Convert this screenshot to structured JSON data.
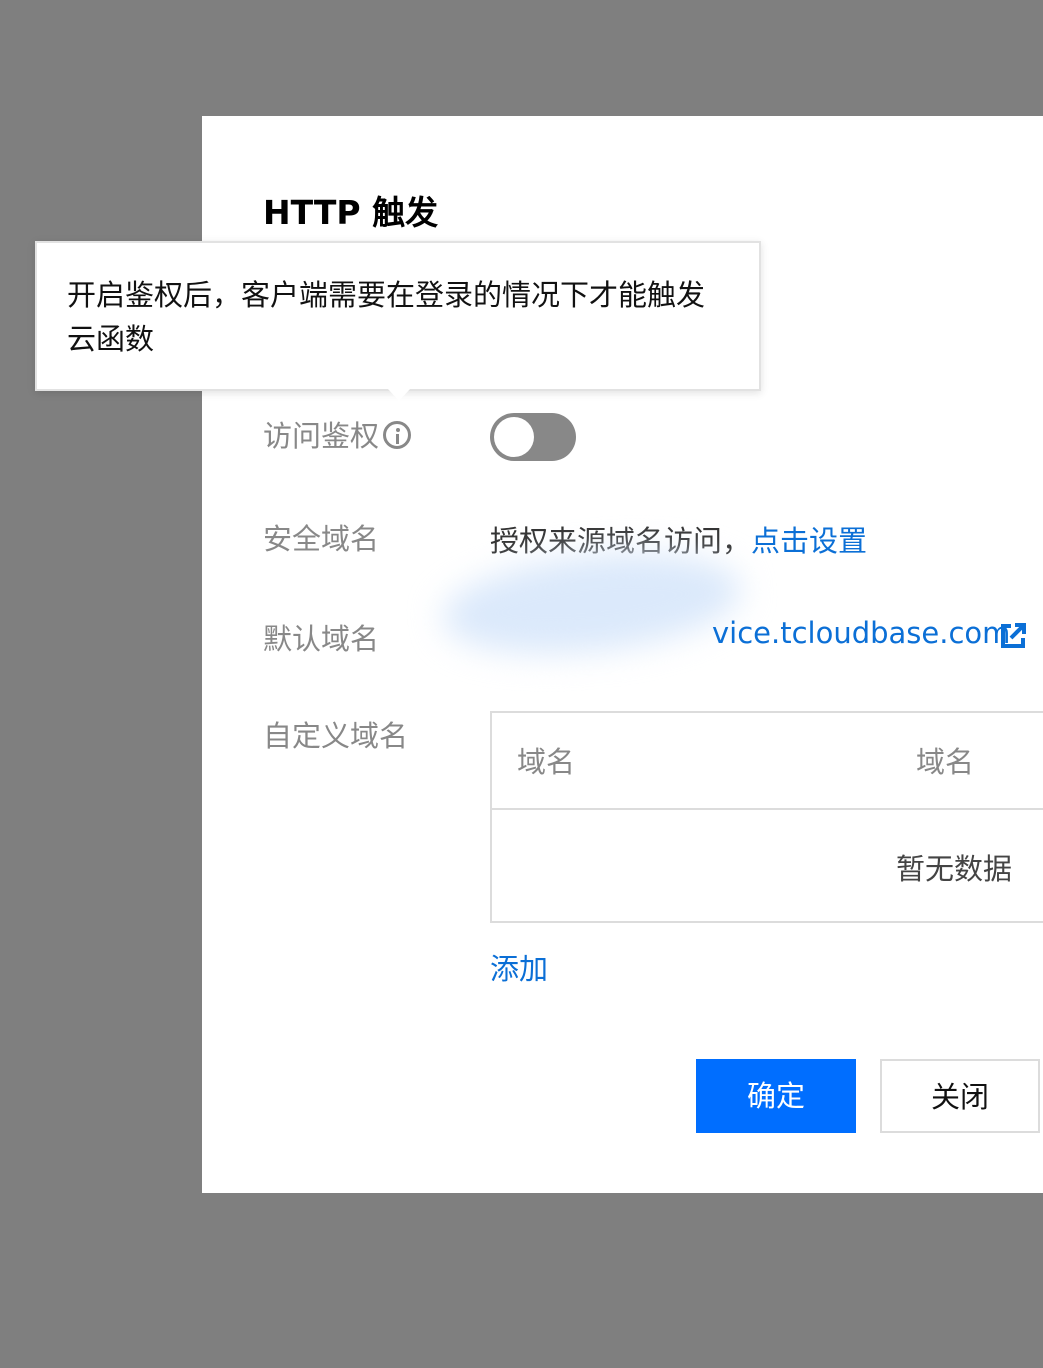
{
  "dialog": {
    "title": "HTTP 触发"
  },
  "tooltip": {
    "text": "开启鉴权后，客户端需要在登录的情况下才能触发云函数"
  },
  "form": {
    "auth": {
      "label": "访问鉴权",
      "enabled": false
    },
    "security_domain": {
      "label": "安全域名",
      "text": "授权来源域名访问，",
      "link": "点击设置"
    },
    "default_domain": {
      "label": "默认域名",
      "value": "vice.tcloudbase.com",
      "icon": "external-link-icon"
    },
    "custom_domain": {
      "label": "自定义域名",
      "table": {
        "columns": [
          "域名",
          "域名"
        ],
        "empty_text": "暂无数据"
      },
      "add_label": "添加"
    }
  },
  "buttons": {
    "confirm": "确定",
    "close": "关闭"
  },
  "colors": {
    "overlay": "#7f7f7f",
    "link": "#0b6fd6",
    "primary": "#006eff",
    "toggle_off": "#888888"
  }
}
